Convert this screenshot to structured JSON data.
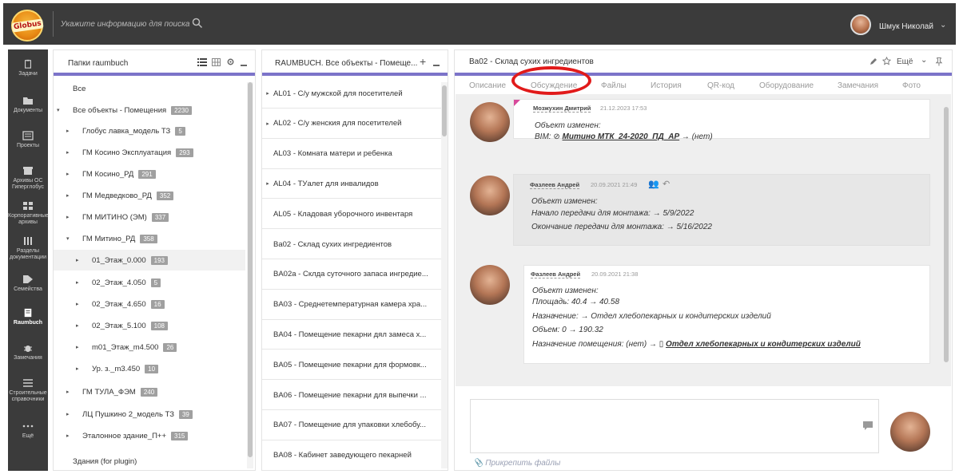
{
  "header": {
    "logo_text": "Globus",
    "search_placeholder": "Укажите информацию для поиска",
    "user_name": "Шмук Николай"
  },
  "nav": {
    "items": [
      {
        "label": "Задачи",
        "icon": "clipboard-icon"
      },
      {
        "label": "Документы",
        "icon": "folder-icon"
      },
      {
        "label": "Проекты",
        "icon": "projects-icon"
      },
      {
        "label": "Архивы ОС Гиперглобус",
        "icon": "archive-icon"
      },
      {
        "label": "Корпоративные архивы",
        "icon": "grid-icon"
      },
      {
        "label": "Разделы документации",
        "icon": "sections-icon"
      },
      {
        "label": "Семейства",
        "icon": "tag-icon"
      },
      {
        "label": "Raumbuch",
        "icon": "book-icon"
      },
      {
        "label": "Замечания",
        "icon": "bug-icon"
      },
      {
        "label": "Строительные справочники",
        "icon": "list-icon"
      },
      {
        "label": "Ещё",
        "icon": "more-icon"
      }
    ]
  },
  "folders": {
    "title": "Папки raumbuch",
    "rows": [
      {
        "label": "Все",
        "badge": "",
        "arrow": "",
        "indent": 0
      },
      {
        "label": "Все объекты - Помещения",
        "badge": "2230",
        "arrow": "▾",
        "indent": 0
      },
      {
        "label": "Глобус лавка_модель ТЗ",
        "badge": "5",
        "arrow": "▸",
        "indent": 1
      },
      {
        "label": "ГМ Косино Эксплуатация",
        "badge": "293",
        "arrow": "▸",
        "indent": 1
      },
      {
        "label": "ГМ Косино_РД",
        "badge": "291",
        "arrow": "▸",
        "indent": 1
      },
      {
        "label": "ГМ Медведково_РД",
        "badge": "352",
        "arrow": "▸",
        "indent": 1
      },
      {
        "label": "ГМ МИТИНО (ЭМ)",
        "badge": "337",
        "arrow": "▸",
        "indent": 1
      },
      {
        "label": "ГМ Митино_РД",
        "badge": "358",
        "arrow": "▾",
        "indent": 1
      },
      {
        "label": "01_Этаж_0.000",
        "badge": "193",
        "arrow": "▸",
        "indent": 2
      },
      {
        "label": "02_Этаж_4.050",
        "badge": "5",
        "arrow": "▸",
        "indent": 2
      },
      {
        "label": "02_Этаж_4.650",
        "badge": "16",
        "arrow": "▸",
        "indent": 2
      },
      {
        "label": "02_Этаж_5.100",
        "badge": "108",
        "arrow": "▸",
        "indent": 2
      },
      {
        "label": "m01_Этаж_m4.500",
        "badge": "26",
        "arrow": "▸",
        "indent": 2
      },
      {
        "label": "Ур. з._m3.450",
        "badge": "10",
        "arrow": "▸",
        "indent": 2
      },
      {
        "label": "ГМ ТУЛА_ФЭМ",
        "badge": "240",
        "arrow": "▸",
        "indent": 1
      },
      {
        "label": "ЛЦ Пушкино 2_модель ТЗ",
        "badge": "39",
        "arrow": "▸",
        "indent": 1
      },
      {
        "label": "Эталонное здание_П++",
        "badge": "315",
        "arrow": "▸",
        "indent": 1
      },
      {
        "label": "Здания (for plugin)",
        "badge": "",
        "arrow": "",
        "indent": 0
      }
    ]
  },
  "rooms": {
    "title": "RAUMBUCH. Все объекты - Помеще...",
    "rows": [
      {
        "label": "AL01 - С/у мужской для посетителей",
        "arrow": "▸"
      },
      {
        "label": "AL02 - С/у женския для посетителей",
        "arrow": "▸"
      },
      {
        "label": "AL03 - Комната матери и ребенка",
        "arrow": ""
      },
      {
        "label": "AL04 - ТУалет для инвалидов",
        "arrow": "▸"
      },
      {
        "label": "AL05 - Кладовая уборочного инвентаря",
        "arrow": ""
      },
      {
        "label": "Ba02 - Склад сухих ингредиентов",
        "arrow": ""
      },
      {
        "label": "BA02a - Склда суточного запаса ингредие...",
        "arrow": ""
      },
      {
        "label": "BA03 - Среднетемпературная камера хра...",
        "arrow": ""
      },
      {
        "label": "BA04 - Помещение пекарни дял замеса х...",
        "arrow": ""
      },
      {
        "label": "BA05 - Помещение пекарни для формовк...",
        "arrow": ""
      },
      {
        "label": "BA06 - Помещение пекарни для выпечки ...",
        "arrow": ""
      },
      {
        "label": "BA07 - Помещение для упаковки хлебобу...",
        "arrow": ""
      },
      {
        "label": "BA08 - Кабинет заведующего пекарней",
        "arrow": ""
      }
    ]
  },
  "detail": {
    "title": "Ba02 - Склад сухих ингредиентов",
    "more_label": "Ещё",
    "tabs": [
      "Описание",
      "Обсуждение",
      "Файлы",
      "История",
      "QR-код",
      "Оборудование",
      "Замечания",
      "Фото"
    ],
    "comments": [
      {
        "author": "Мозжухин Дмитрий",
        "date": "21.12.2023 17:53",
        "line1": "Объект изменен:",
        "line2_prefix": "BIM: ",
        "line2_link": "Митино МТК_24-2020_ПД_АР",
        "line2_suffix": " → (нет)"
      },
      {
        "author": "Фазлеев Андрей",
        "date": "20.09.2021 21:49",
        "lines": [
          "Объект изменен:",
          "Начало передачи для монтажа: → 5/9/2022",
          "Окончание передачи для монтажа: → 5/16/2022"
        ]
      },
      {
        "author": "Фазлеев Андрей",
        "date": "20.09.2021 21:38",
        "lines": [
          "Объект изменен:",
          "Площадь: 40.4 → 40.58",
          "Назначение: → Отдел хлебопекарных и кондитерских изделий",
          "Объем: 0 → 190.32"
        ],
        "last_prefix": "Назначение помещения: (нет) → ",
        "last_link": "Отдел хлебопекарных и кондитерских изделий"
      }
    ],
    "attach_label": "Прикрепить файлы"
  },
  "colors": {
    "accent": "#7c73c9",
    "nav_bg": "#3b3b3b",
    "highlight": "#e11a1a"
  }
}
